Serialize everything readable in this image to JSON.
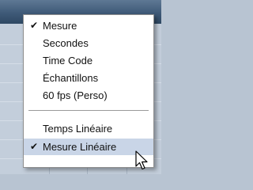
{
  "menu": {
    "items": [
      {
        "label": "Mesure",
        "checked": true
      },
      {
        "label": "Secondes",
        "checked": false
      },
      {
        "label": "Time Code",
        "checked": false
      },
      {
        "label": "Échantillons",
        "checked": false
      },
      {
        "label": "60 fps (Perso)",
        "checked": false
      },
      {
        "label": "Temps Linéaire",
        "checked": false
      },
      {
        "label": "Mesure Linéaire",
        "checked": true
      }
    ],
    "check_glyph": "✔"
  },
  "colors": {
    "highlight": "#c9d5e7",
    "menu_background": "#ffffff",
    "window_header": "#3f5a78"
  },
  "icons": {
    "check": "check-icon",
    "cursor": "mouse-pointer-icon"
  }
}
